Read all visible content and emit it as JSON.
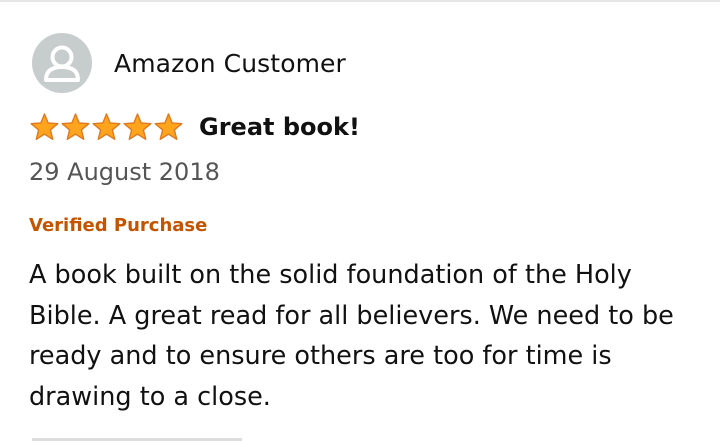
{
  "review": {
    "profile_name": "Amazon Customer",
    "avatar_icon": "person-icon",
    "rating": 5,
    "rating_max": 5,
    "star_color": "#ffa41c",
    "star_outline": "#de7921",
    "title": "Great book!",
    "date": "29 August 2018",
    "verified_label": "Verified Purchase",
    "verified_color": "#c45500",
    "body": "A book built on the solid foundation of the Holy Bible. A great read for all believers. We need to be ready and to ensure others are too for time is drawing to a close."
  }
}
